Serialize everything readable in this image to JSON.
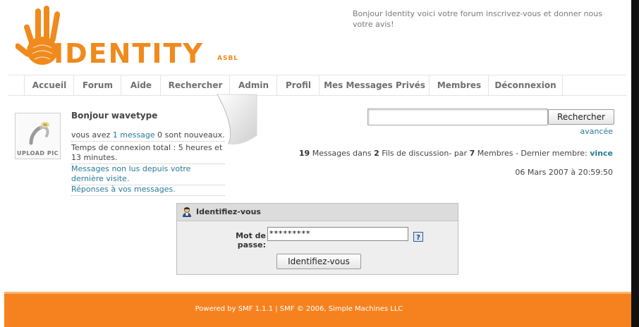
{
  "site": {
    "logo_text": "IDENTITY",
    "logo_suffix": "ASBL",
    "tagline": "Bonjour Identity voici votre forum inscrivez-vous et donner nous votre avis!"
  },
  "nav": {
    "items": [
      {
        "label": "Accueil"
      },
      {
        "label": "Forum"
      },
      {
        "label": "Aide"
      },
      {
        "label": "Rechercher"
      },
      {
        "label": "Admin"
      },
      {
        "label": "Profil"
      },
      {
        "label": "Mes Messages Privés"
      },
      {
        "label": "Membres"
      },
      {
        "label": "Déconnexion"
      }
    ]
  },
  "user_panel": {
    "avatar_label": "UPLOAD PIC",
    "greeting": "Bonjour wavetype",
    "messages_prefix": "vous avez ",
    "messages_link": "1 message",
    "messages_suffix": " 0 sont nouveaux.",
    "login_time": "Temps de connexion total : 5 heures et 13 minutes.",
    "unread_link": "Messages non lus depuis votre dernière visite.",
    "replies_link": "Réponses à vos messages."
  },
  "search": {
    "input_value": "",
    "button_label": "Rechercher",
    "advanced_link": "avancée"
  },
  "stats": {
    "messages_count": "19",
    "messages_label": " Messages dans ",
    "threads_count": "2",
    "threads_label": " Fils de discussion- par ",
    "members_count": "7",
    "members_label": " Membres - Dernier membre: ",
    "latest_member": "vince",
    "date": "06 Mars 2007 à 20:59:50"
  },
  "login": {
    "title": "Identifiez-vous",
    "password_label": "Mot de passe:",
    "password_value": "*********",
    "button_label": "Identifiez-vous"
  },
  "footer": {
    "text": "Powered by SMF 1.1.1 | SMF © 2006, Simple Machines LLC"
  },
  "colors": {
    "brand_orange": "#f08a1c",
    "footer_orange": "#f5821f",
    "link": "#2a7a9a"
  },
  "icons": [
    "hand-logo-icon",
    "avatar-placeholder-icon",
    "user-icon",
    "help-icon"
  ]
}
